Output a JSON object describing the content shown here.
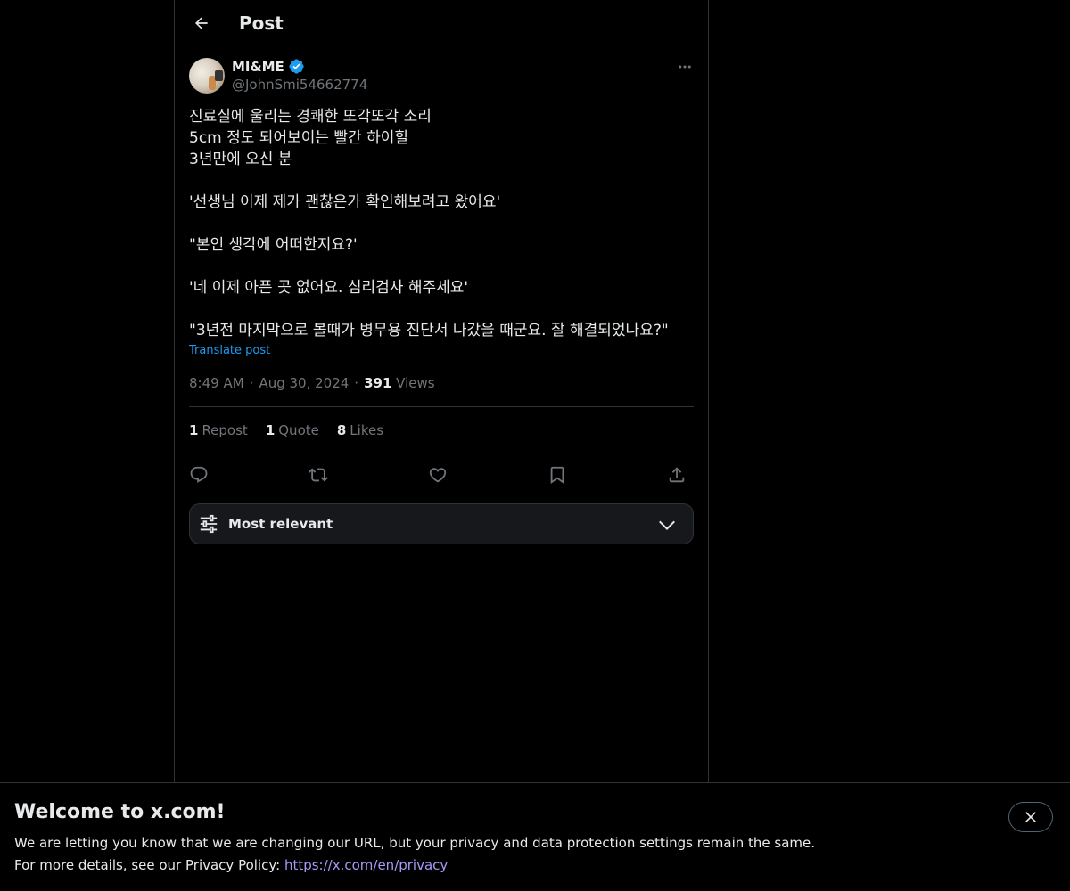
{
  "header": {
    "title": "Post"
  },
  "post": {
    "author": {
      "display_name": "MI&ME",
      "handle": "@JohnSmi54662774",
      "verified": true
    },
    "lines": [
      "진료실에 울리는 경쾌한 또각또각 소리",
      "5cm 정도 되어보이는 빨간 하이힐",
      "3년만에 오신 분",
      "",
      "'선생님 이제 제가 괜찮은가 확인해보려고 왔어요'",
      "",
      "\"본인 생각에 어떠한지요?'",
      "",
      "'네 이제 아픈 곳 없어요. 심리검사 해주세요'",
      "",
      "\"3년전 마지막으로 볼때가 병무용 진단서 나갔을 때군요. 잘 해결되었나요?\""
    ],
    "translate_label": "Translate post",
    "time": "8:49 AM",
    "date": "Aug 30, 2024",
    "separator": "·",
    "views_count": "391",
    "views_label": "Views"
  },
  "stats": {
    "reposts": {
      "count": "1",
      "label": "Repost"
    },
    "quotes": {
      "count": "1",
      "label": "Quote"
    },
    "likes": {
      "count": "8",
      "label": "Likes"
    }
  },
  "actions": [
    "reply-icon",
    "repost-icon",
    "like-icon",
    "bookmark-icon",
    "share-icon"
  ],
  "sort": {
    "label": "Most relevant"
  },
  "banner": {
    "title": "Welcome to x.com!",
    "line1": "We are letting you know that we are changing our URL, but your privacy and data protection settings remain the same.",
    "line2_prefix": "For more details, see our Privacy Policy: ",
    "link": "https://x.com/en/privacy"
  },
  "colors": {
    "background": "#000000",
    "text": "#e7e9ea",
    "muted": "#71767b",
    "accent": "#1d9bf0",
    "verified": "#1d9bf0",
    "border": "#2f3336",
    "link": "#a49bf5"
  }
}
